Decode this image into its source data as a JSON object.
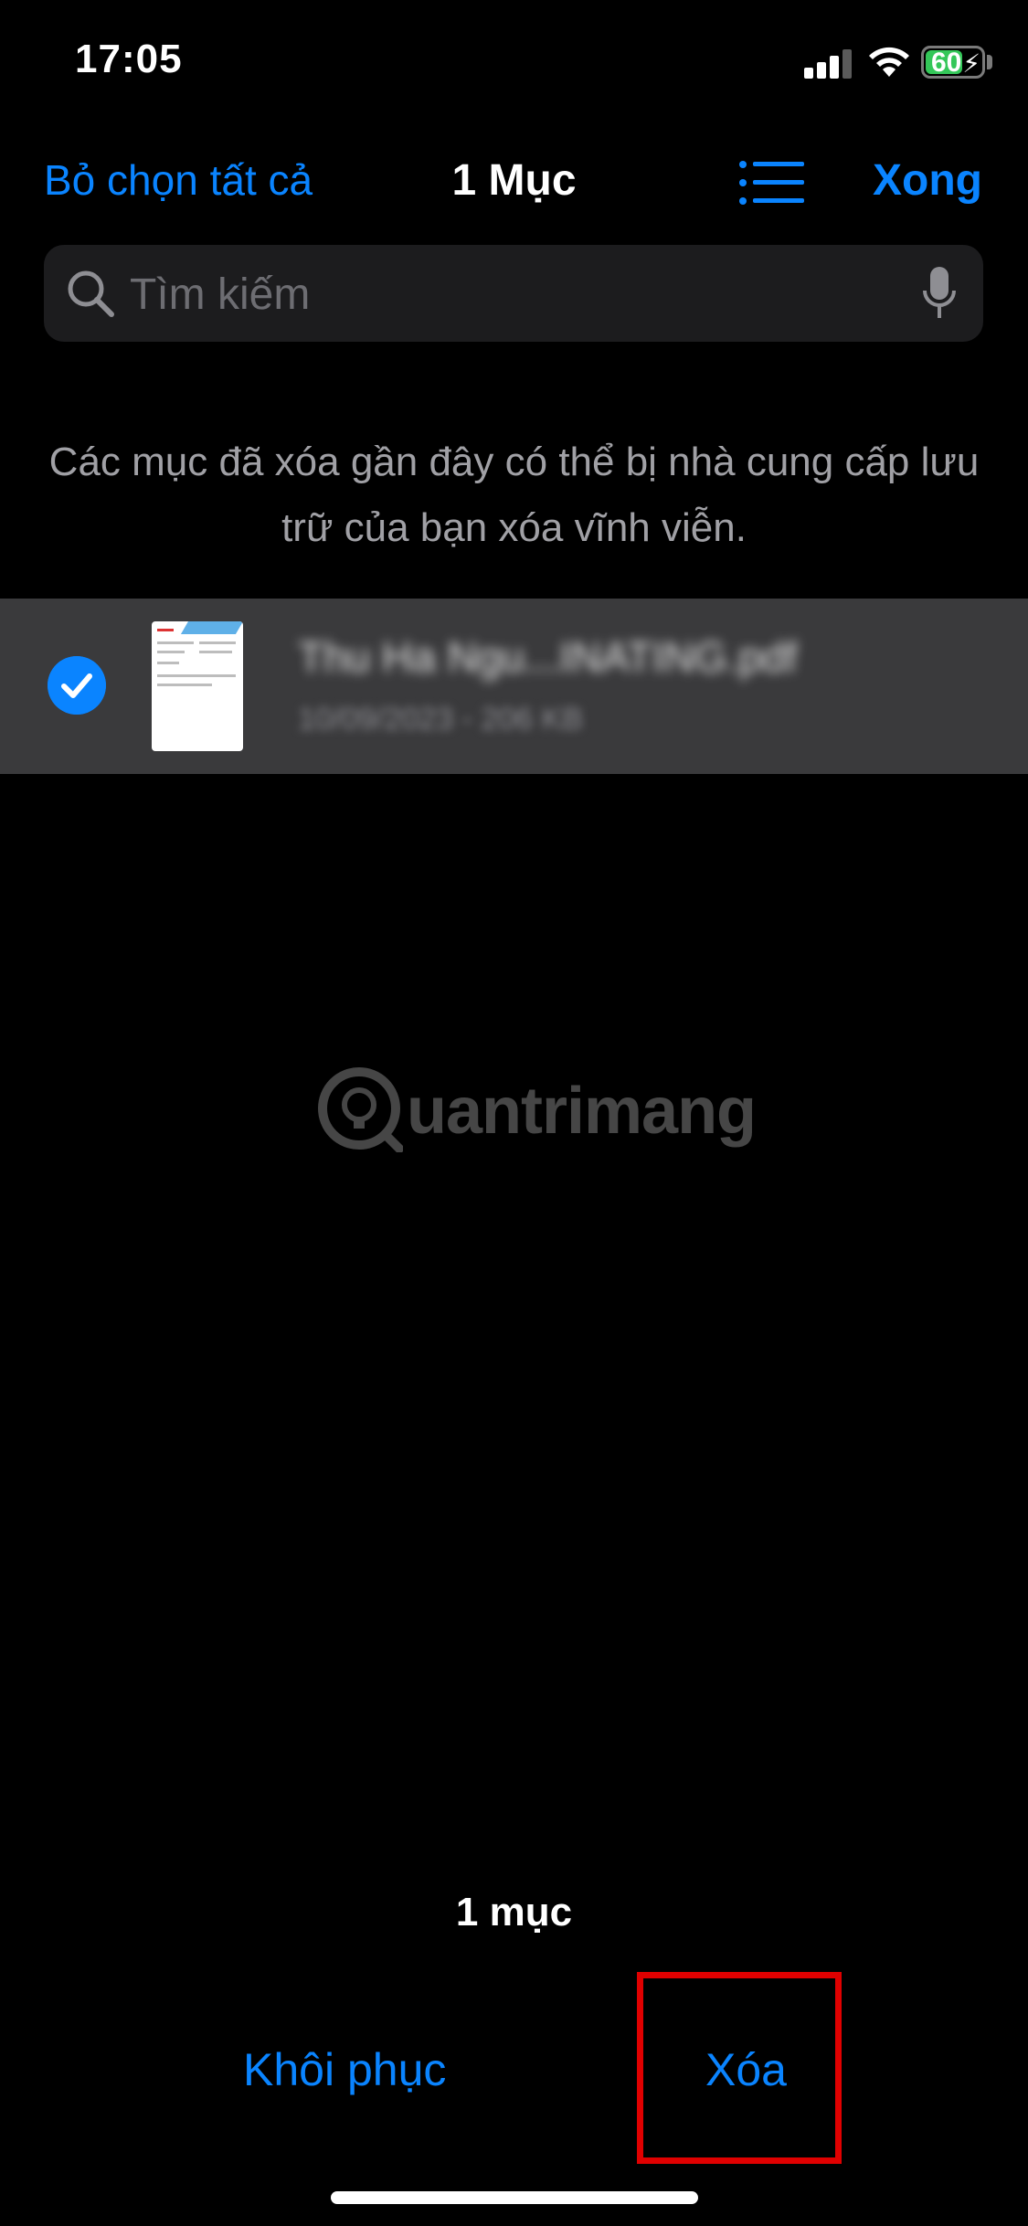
{
  "status_bar": {
    "time": "17:05",
    "battery_percent": "60",
    "battery_charging_symbol": "⚡"
  },
  "nav": {
    "deselect_all_label": "Bỏ chọn tất cả",
    "title": "1 Mục",
    "list_view_icon": "list-icon",
    "done_label": "Xong"
  },
  "search": {
    "placeholder": "Tìm kiếm",
    "value": ""
  },
  "info_message": "Các mục đã xóa gần đây có thể bị nhà cung cấp lưu trữ của bạn xóa vĩnh viễn.",
  "files": [
    {
      "name": "Thu Ha Ngu...INATING.pdf",
      "date": "10/09/2023",
      "size": "206 KB",
      "selected": true
    }
  ],
  "watermark": {
    "text": "uantrimang"
  },
  "toolbar": {
    "count_label": "1 mục",
    "restore_label": "Khôi phục",
    "delete_label": "Xóa"
  },
  "colors": {
    "accent": "#0a84ff",
    "background": "#000000",
    "row_selected": "#3a3a3c",
    "highlight_box": "#e00000",
    "battery": "#34c759"
  }
}
